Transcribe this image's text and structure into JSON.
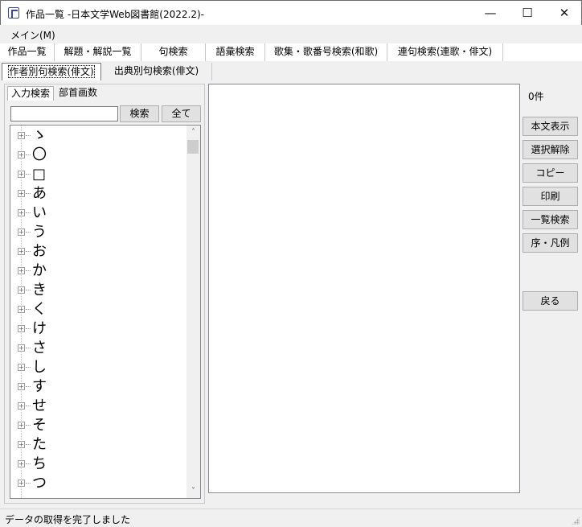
{
  "window": {
    "title": "作品一覧 -日本文学Web図書館(2022.2)-",
    "icon": "app-book-icon",
    "controls": {
      "minimize": "—",
      "maximize": "☐",
      "close": "✕"
    }
  },
  "menu": {
    "items": [
      "メイン(M)"
    ]
  },
  "tabs_row1": [
    "作品一覧",
    "解題・解説一覧",
    "句検索",
    "語彙検索",
    "歌集・歌番号検索(和歌)",
    "連句検索(連歌・俳文)"
  ],
  "tabs_row2": [
    "作者別句検索(俳文)",
    "出典別句検索(俳文)"
  ],
  "left_panel": {
    "subtabs": [
      "入力検索",
      "部首画数"
    ],
    "search_value": "",
    "search_button": "検索",
    "all_button": "全て",
    "tree_items": [
      "ゝ",
      "〇",
      "□",
      "あ",
      "い",
      "う",
      "お",
      "か",
      "き",
      "く",
      "け",
      "さ",
      "し",
      "す",
      "せ",
      "そ",
      "た",
      "ち",
      "つ"
    ],
    "expander_glyph": "+",
    "scroll_up": "˄",
    "scroll_down": "˅"
  },
  "right_panel": {
    "count": "0件",
    "buttons": [
      "本文表示",
      "選択解除",
      "コピー",
      "印刷",
      "一覧検索",
      "序・凡例"
    ],
    "back_button": "戻る"
  },
  "status": {
    "text": "データの取得を完了しました"
  },
  "colors": {
    "window_bg": "#f0f0f0",
    "white": "#ffffff",
    "button_bg": "#e1e1e1",
    "border": "#adadad"
  }
}
